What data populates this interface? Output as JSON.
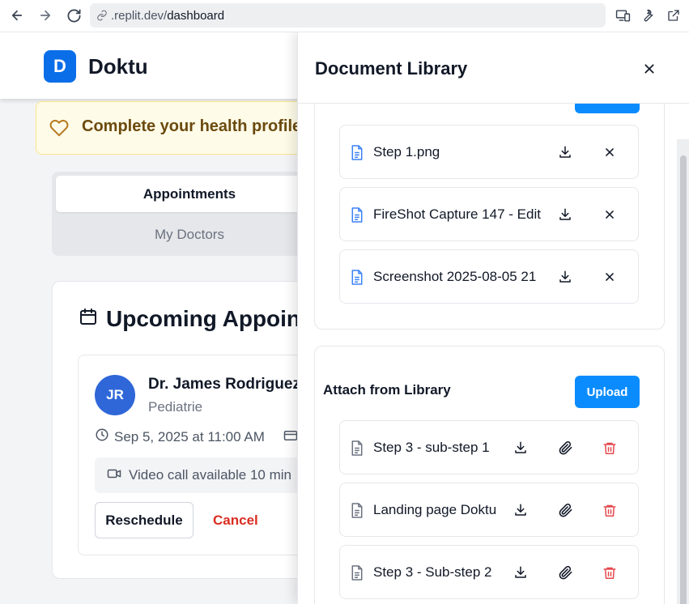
{
  "browser": {
    "url_prefix": ".replit.dev/",
    "url_path": "dashboard"
  },
  "app": {
    "logo_letter": "D",
    "name": "Doktu",
    "profile_banner": "Complete your health profile",
    "tabs": [
      "Appointments",
      "My Doctors"
    ],
    "appointments_title": "Upcoming Appoin",
    "appointment": {
      "initials": "JR",
      "doctor": "Dr. James Rodriguez",
      "specialty": "Pediatrie",
      "datetime": "Sep 5, 2025 at 11:00 AM",
      "video_note": "Video call available 10 min",
      "reschedule_label": "Reschedule",
      "cancel_label": "Cancel"
    }
  },
  "drawer": {
    "title": "Document Library",
    "uploaded_files": [
      {
        "name": "Step 1.png"
      },
      {
        "name": "FireShot Capture 147 - Edit"
      },
      {
        "name": "Screenshot 2025-08-05 21"
      }
    ],
    "library_section": {
      "title": "Attach from Library",
      "upload_label": "Upload",
      "files": [
        {
          "name": "Step 3 - sub-step 1"
        },
        {
          "name": "Landing page Doktu"
        },
        {
          "name": "Step 3 - Sub-step 2"
        }
      ]
    }
  },
  "colors": {
    "primary": "#0a8cff",
    "brand": "#0a6ee8",
    "danger": "#e5484d",
    "file_icon_blue": "#3b82f6",
    "file_icon_gray": "#6b7280"
  }
}
